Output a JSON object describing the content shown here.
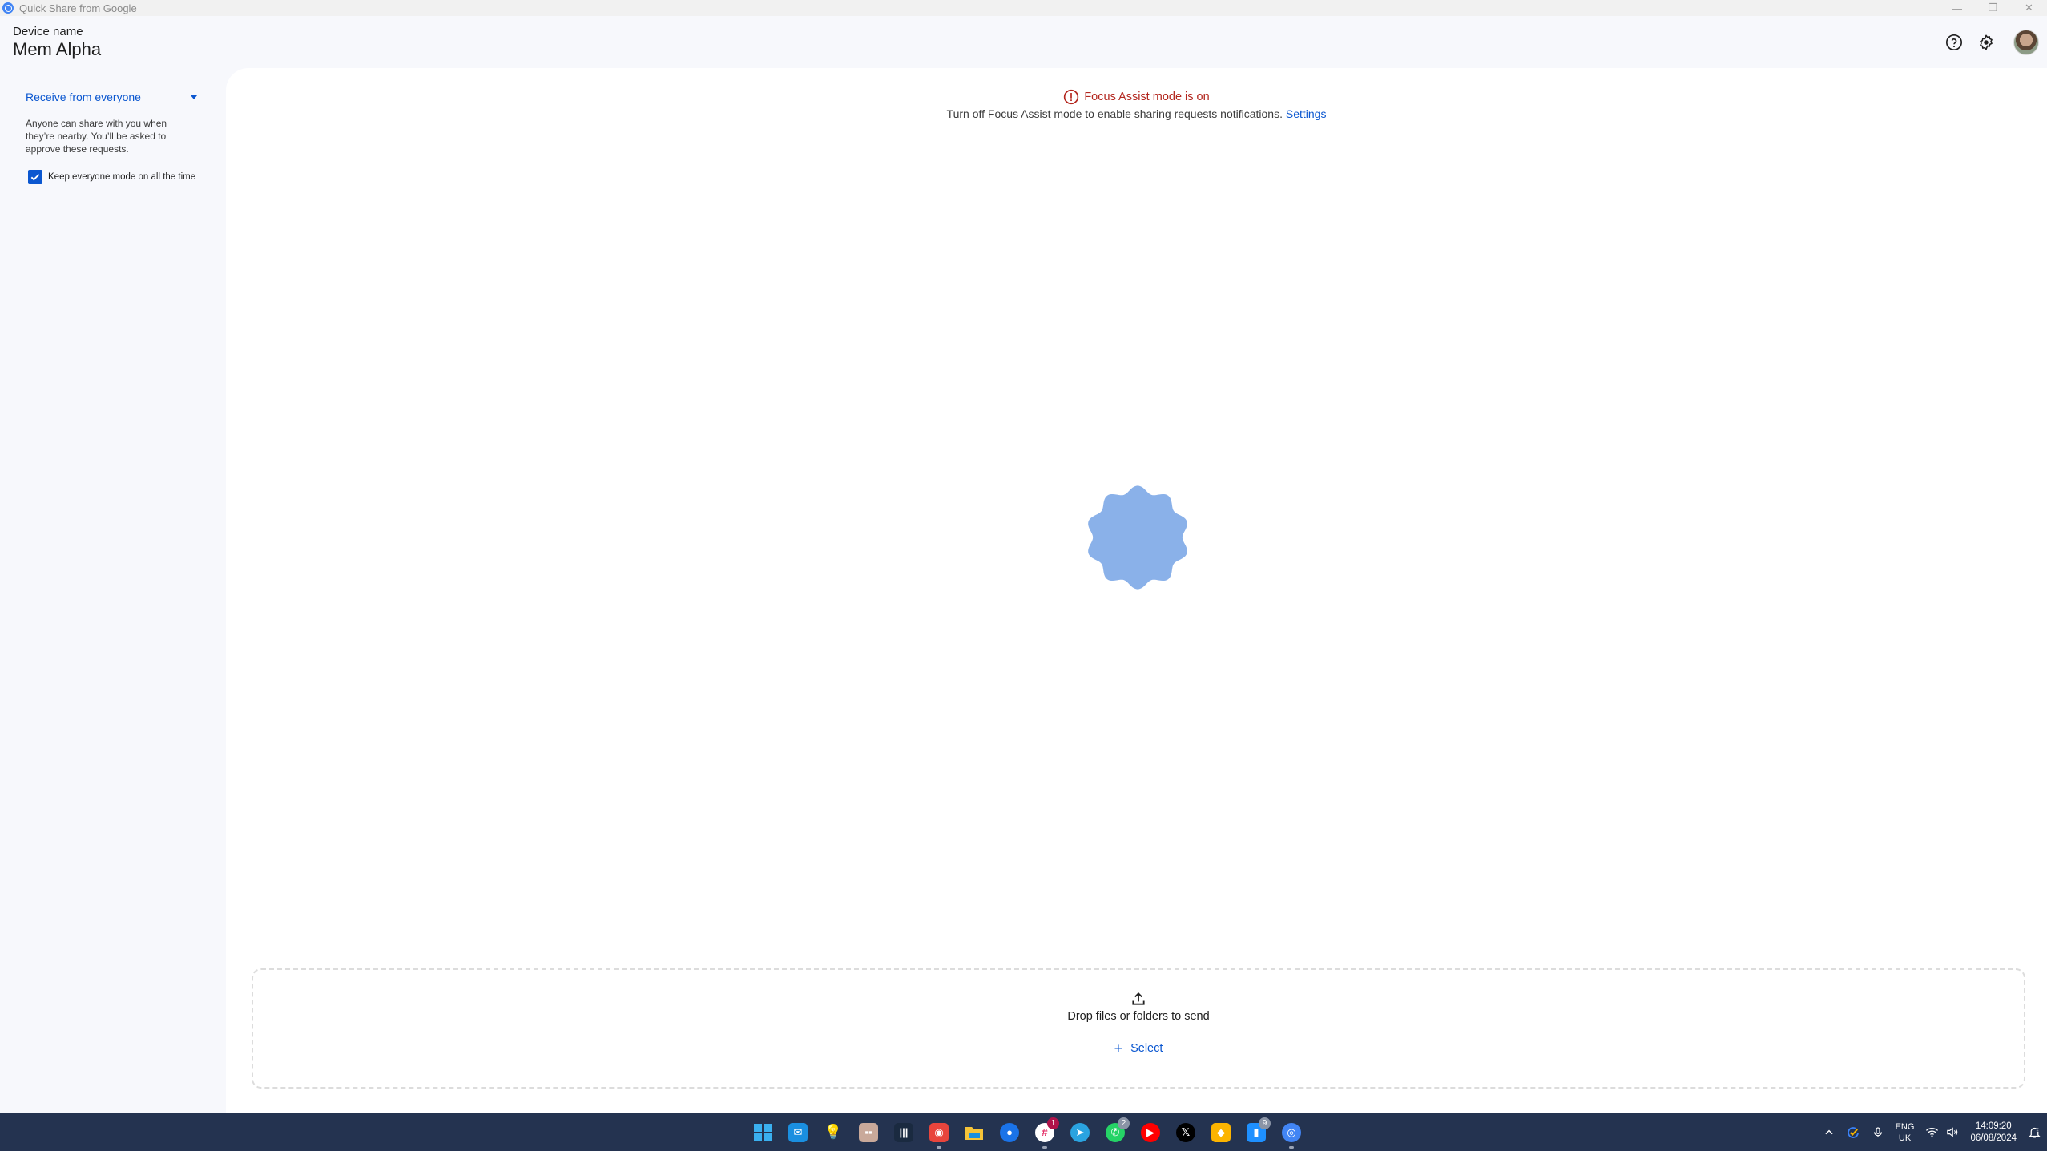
{
  "window": {
    "title": "Quick Share from Google",
    "controls": {
      "minimize": "—",
      "restore": "❐",
      "close": "✕"
    }
  },
  "header": {
    "device_label": "Device name",
    "device_name": "Mem Alpha",
    "icons": [
      "help-icon",
      "settings-icon",
      "avatar"
    ]
  },
  "sidebar": {
    "receive_mode": "Receive from everyone",
    "description": "Anyone can share with you when they’re nearby. You’ll be asked to approve these requests.",
    "keep_everyone_label": "Keep everyone mode on all the time",
    "keep_everyone_checked": true
  },
  "alert": {
    "title": "Focus Assist mode is on",
    "description": "Turn off Focus Assist mode to enable sharing requests notifications.",
    "link": "Settings",
    "color": "#b3261e"
  },
  "main": {
    "blob_color": "#8ab1e9",
    "drop_text": "Drop files or folders to send",
    "select_label": "Select",
    "accent": "#0b57d0"
  },
  "taskbar": {
    "apps": [
      {
        "name": "start",
        "glyph": "",
        "color": "#3ab0f0"
      },
      {
        "name": "mail",
        "glyph": "✉",
        "color": "#1a8fe0"
      },
      {
        "name": "tips",
        "glyph": "💡",
        "color": "transparent"
      },
      {
        "name": "app-robot",
        "glyph": "▪▪",
        "color": "#c9a99a"
      },
      {
        "name": "app-equalizer",
        "glyph": "|||",
        "color": "#1a2a40"
      },
      {
        "name": "chrome",
        "glyph": "◉",
        "color": "#e8453c",
        "running": true
      },
      {
        "name": "file-explorer",
        "glyph": "",
        "color": "#f5c338"
      },
      {
        "name": "messages",
        "glyph": "●",
        "color": "#1a73e8"
      },
      {
        "name": "slack",
        "glyph": "#",
        "color": "#ffffff",
        "badge": "1",
        "badge_color": "#b0134a",
        "running": true
      },
      {
        "name": "telegram",
        "glyph": "➤",
        "color": "#2aa3e0"
      },
      {
        "name": "whatsapp",
        "glyph": "✆",
        "color": "#25d366",
        "badge": "2",
        "badge_color": "#8a94a6"
      },
      {
        "name": "youtube-music",
        "glyph": "▶",
        "color": "#ff0000"
      },
      {
        "name": "x",
        "glyph": "𝕏",
        "color": "#000000"
      },
      {
        "name": "airtable",
        "glyph": "◆",
        "color": "#fcb400"
      },
      {
        "name": "app-blue",
        "glyph": "▮",
        "color": "#1e90ff",
        "badge": "9",
        "badge_color": "#8a94a6"
      },
      {
        "name": "quick-share",
        "glyph": "◎",
        "color": "#4285f4",
        "running": true
      }
    ],
    "tray": {
      "language_top": "ENG",
      "language_bottom": "UK",
      "time": "14:09:20",
      "date": "06/08/2024"
    }
  }
}
